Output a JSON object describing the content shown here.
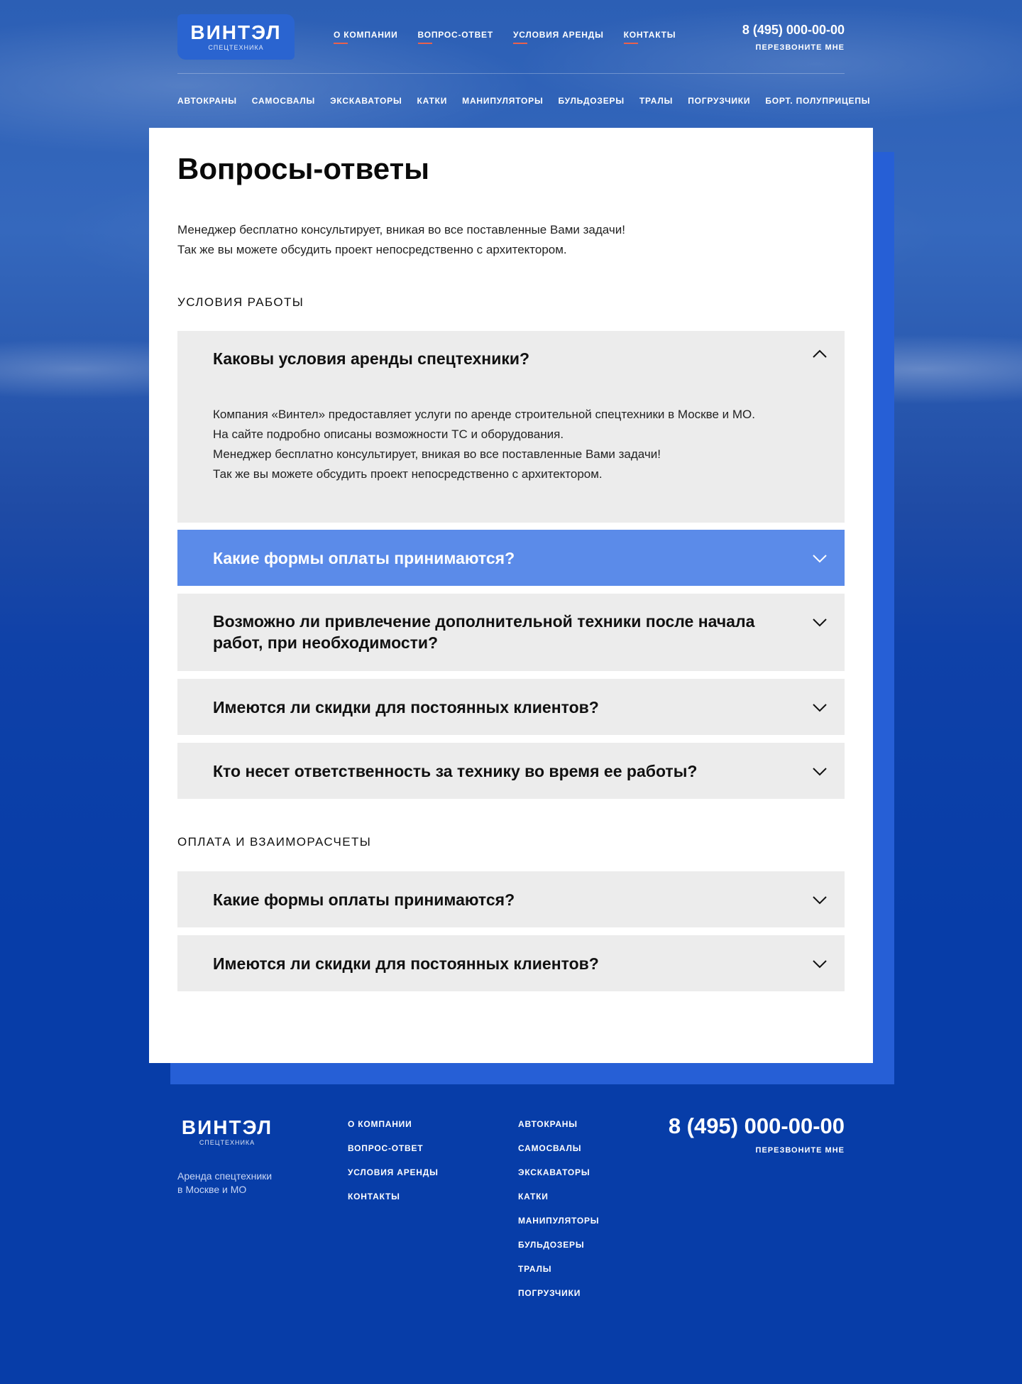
{
  "header": {
    "logo_word": "ВИНТЭЛ",
    "logo_sub": "СПЕЦТЕХНИКА",
    "nav": [
      "О КОМПАНИИ",
      "ВОПРОС-ОТВЕТ",
      "УСЛОВИЯ АРЕНДЫ",
      "КОНТАКТЫ"
    ],
    "phone": "8 (495) 000-00-00",
    "callback": "ПЕРЕЗВОНИТЕ МНЕ"
  },
  "categories": [
    "АВТОКРАНЫ",
    "САМОСВАЛЫ",
    "ЭКСКАВАТОРЫ",
    "КАТКИ",
    "МАНИПУЛЯТОРЫ",
    "БУЛЬДОЗЕРЫ",
    "ТРАЛЫ",
    "ПОГРУЗЧИКИ",
    "БОРТ. ПОЛУПРИЦЕПЫ"
  ],
  "main": {
    "title": "Вопросы-ответы",
    "intro": [
      "Менеджер бесплатно консультирует, вникая во все поставленные Вами задачи!",
      "Так же вы можете обсудить проект непосредственно с архитектором."
    ],
    "sections": [
      {
        "title": "УСЛОВИЯ РАБОТЫ",
        "items": [
          {
            "question": "Каковы условия аренды спецтехники?",
            "expanded": true,
            "answer": [
              "Компания «Винтел» предоставляет услуги по аренде строительной спецтехники в Москве и МО.",
              "На сайте подробно описаны возможности ТС и оборудования.",
              "Менеджер бесплатно консультирует, вникая во все поставленные Вами задачи!",
              "Так же вы можете обсудить проект непосредственно с архитектором."
            ]
          },
          {
            "question": "Какие формы оплаты принимаются?",
            "highlighted": true
          },
          {
            "question": "Возможно ли привлечение дополнительной техники после начала работ, при необходимости?"
          },
          {
            "question": "Имеются ли скидки для постоянных клиентов?"
          },
          {
            "question": "Кто несет ответственность за технику во время ее работы?"
          }
        ]
      },
      {
        "title": "ОПЛАТА И ВЗАИМОРАСЧЕТЫ",
        "items": [
          {
            "question": "Какие формы оплаты принимаются?"
          },
          {
            "question": "Имеются ли скидки для постоянных клиентов?"
          }
        ]
      }
    ]
  },
  "footer": {
    "logo_word": "ВИНТЭЛ",
    "logo_sub": "СПЕЦТЕХНИКА",
    "desc": [
      "Аренда спецтехники",
      "в Москве и МО"
    ],
    "col1": [
      "О КОМПАНИИ",
      "ВОПРОС-ОТВЕТ",
      "УСЛОВИЯ АРЕНДЫ",
      "КОНТАКТЫ"
    ],
    "col2": [
      "АВТОКРАНЫ",
      "САМОСВАЛЫ",
      "ЭКСКАВАТОРЫ",
      "КАТКИ",
      "МАНИПУЛЯТОРЫ",
      "БУЛЬДОЗЕРЫ",
      "ТРАЛЫ",
      "ПОГРУЗЧИКИ"
    ],
    "phone": "8 (495) 000-00-00",
    "callback": "ПЕРЕЗВОНИТЕ МНЕ"
  },
  "colors": {
    "primary_blue": "#073da8",
    "accent_blue": "#265fd6",
    "highlight": "#5b8be9",
    "underline": "#e8614d",
    "faq_bg": "#ececec"
  }
}
